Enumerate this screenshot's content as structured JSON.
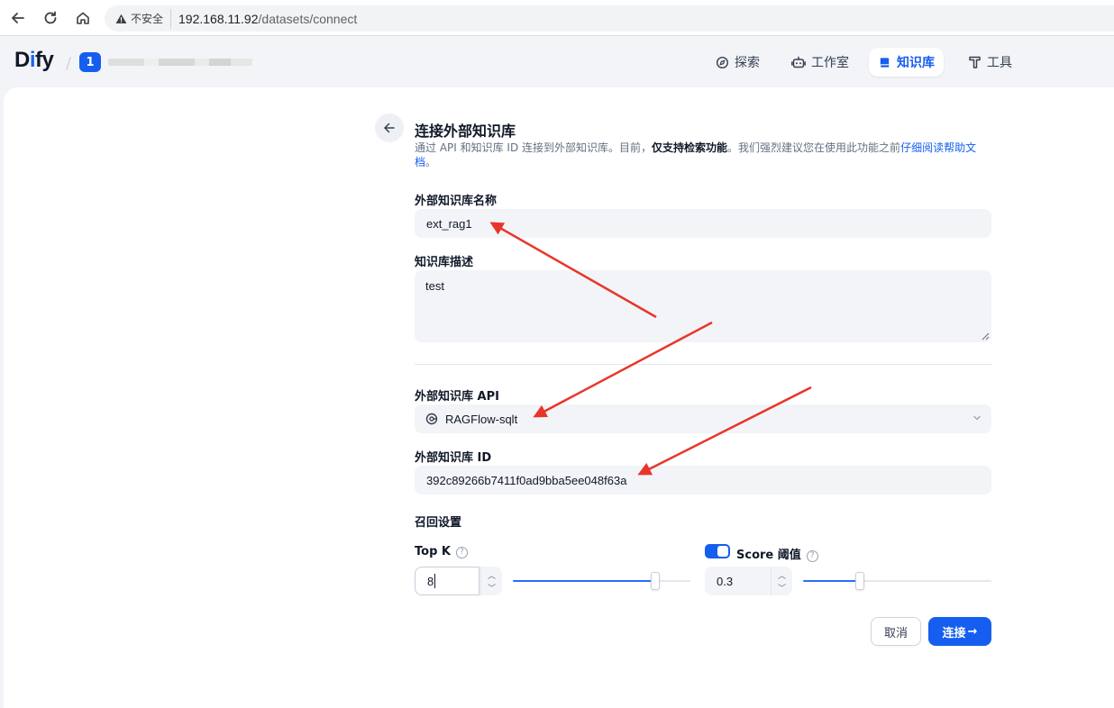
{
  "browser": {
    "insecure_label": "不安全",
    "url_host": "192.168.11.92",
    "url_path": "/datasets/connect"
  },
  "header": {
    "logo_prefix": "D",
    "logo_accent": "i",
    "logo_suffix": "fy",
    "workspace_badge": "1",
    "nav": [
      {
        "label": "探索",
        "icon": "compass-icon",
        "active": false
      },
      {
        "label": "工作室",
        "icon": "robot-icon",
        "active": false
      },
      {
        "label": "知识库",
        "icon": "book-icon",
        "active": true
      },
      {
        "label": "工具",
        "icon": "hammer-icon",
        "active": false
      }
    ],
    "accent_color": "#155eef"
  },
  "form": {
    "title": "连接外部知识库",
    "desc_part1": "通过 API 和知识库 ID 连接到外部知识库。目前，",
    "desc_strong": "仅支持检索功能",
    "desc_part2": "。我们强烈建议您在使用此功能之前",
    "desc_link": "仔细阅读帮助文档",
    "desc_end": "。",
    "name_label": "外部知识库名称",
    "name_value": "ext_rag1",
    "desc_label": "知识库描述",
    "desc_value": "test",
    "api_label": "外部知识库 API",
    "api_value": "RAGFlow-sqlt",
    "id_label": "外部知识库 ID",
    "id_value": "392c89266b7411f0ad9bba5ee048f63a",
    "retrieval_label": "召回设置",
    "topk_label": "Top K",
    "topk_value": "8",
    "topk_slider_fraction": 0.8,
    "score_label": "Score 阈值",
    "score_enabled": true,
    "score_value": "0.3",
    "score_slider_fraction": 0.3,
    "cancel_label": "取消",
    "connect_label": "连接",
    "connect_arrow": "→"
  }
}
